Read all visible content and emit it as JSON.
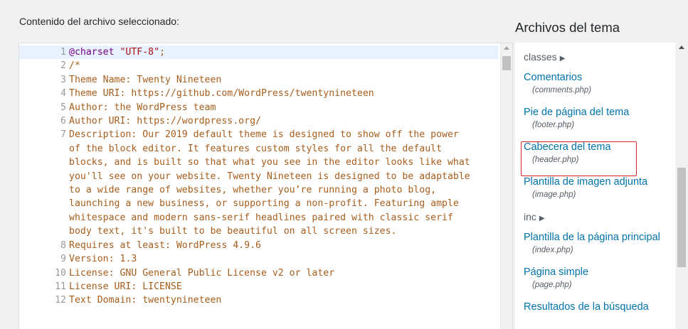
{
  "editor": {
    "label": "Contenido del archivo seleccionado:",
    "lines": [
      {
        "num": "1",
        "segments": [
          {
            "t": "@charset",
            "c": "cs"
          },
          {
            "t": " ",
            "c": ""
          },
          {
            "t": "\"UTF-8\"",
            "c": "str"
          },
          {
            "t": ";",
            "c": ""
          }
        ]
      },
      {
        "num": "2",
        "segments": [
          {
            "t": "/*",
            "c": ""
          }
        ]
      },
      {
        "num": "3",
        "segments": [
          {
            "t": "Theme Name: Twenty Nineteen",
            "c": ""
          }
        ]
      },
      {
        "num": "4",
        "segments": [
          {
            "t": "Theme URI: https://github.com/WordPress/twentynineteen",
            "c": ""
          }
        ]
      },
      {
        "num": "5",
        "segments": [
          {
            "t": "Author: the WordPress team",
            "c": ""
          }
        ]
      },
      {
        "num": "6",
        "segments": [
          {
            "t": "Author URI: https://wordpress.org/",
            "c": ""
          }
        ]
      },
      {
        "num": "7",
        "segments": [
          {
            "t": "Description: Our 2019 default theme is designed to show off the power",
            "c": ""
          }
        ]
      },
      {
        "num": "",
        "segments": [
          {
            "t": "of the block editor. It features custom styles for all the default",
            "c": ""
          }
        ]
      },
      {
        "num": "",
        "segments": [
          {
            "t": "blocks, and is built so that what you see in the editor looks like what",
            "c": ""
          }
        ]
      },
      {
        "num": "",
        "segments": [
          {
            "t": "you'll see on your website. Twenty Nineteen is designed to be adaptable",
            "c": ""
          }
        ]
      },
      {
        "num": "",
        "segments": [
          {
            "t": "to a wide range of websites, whether you’re running a photo blog,",
            "c": ""
          }
        ]
      },
      {
        "num": "",
        "segments": [
          {
            "t": "launching a new business, or supporting a non-profit. Featuring ample",
            "c": ""
          }
        ]
      },
      {
        "num": "",
        "segments": [
          {
            "t": "whitespace and modern sans-serif headlines paired with classic serif",
            "c": ""
          }
        ]
      },
      {
        "num": "",
        "segments": [
          {
            "t": "body text, it's built to be beautiful on all screen sizes.",
            "c": ""
          }
        ]
      },
      {
        "num": "8",
        "segments": [
          {
            "t": "Requires at least: WordPress 4.9.6",
            "c": ""
          }
        ]
      },
      {
        "num": "9",
        "segments": [
          {
            "t": "Version: 1.3",
            "c": ""
          }
        ]
      },
      {
        "num": "10",
        "segments": [
          {
            "t": "License: GNU General Public License v2 or later",
            "c": ""
          }
        ]
      },
      {
        "num": "11",
        "segments": [
          {
            "t": "License URI: LICENSE",
            "c": ""
          }
        ]
      },
      {
        "num": "12",
        "segments": [
          {
            "t": "Text Domain: twentynineteen",
            "c": ""
          }
        ]
      }
    ]
  },
  "sidebar": {
    "title": "Archivos del tema",
    "entries": [
      {
        "type": "folder",
        "label": "classes",
        "arrow": "▶"
      },
      {
        "type": "file",
        "label": "Comentarios",
        "path": "(comments.php)"
      },
      {
        "type": "file",
        "label": "Pie de página del tema",
        "path": "(footer.php)"
      },
      {
        "type": "file",
        "label": "Cabecera del tema",
        "path": "(header.php)",
        "highlighted": true
      },
      {
        "type": "file",
        "label": "Plantilla de imagen adjunta",
        "path": "(image.php)"
      },
      {
        "type": "folder",
        "label": "inc",
        "arrow": "▶"
      },
      {
        "type": "file",
        "label": "Plantilla de la página principal",
        "path": "(index.php)"
      },
      {
        "type": "file",
        "label": "Página simple",
        "path": "(page.php)"
      },
      {
        "type": "file",
        "label": "Resultados de la búsqueda",
        "path": ""
      }
    ]
  },
  "colors": {
    "link": "#0073aa",
    "highlight_border": "#d9262b",
    "code_text": "#a65d1c"
  }
}
